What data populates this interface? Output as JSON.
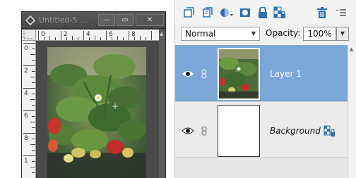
{
  "document_window": {
    "title": "Untitled-5 ...",
    "min_glyph": "—",
    "max_glyph": "▭",
    "close_glyph": "✕",
    "ruler_top_ticks": [
      "0",
      "2",
      "4",
      "6",
      "8"
    ],
    "ruler_left_ticks": [
      "0",
      "2",
      "4",
      "6",
      "8",
      "1"
    ]
  },
  "layers_panel": {
    "blend_mode": "Normal",
    "opacity_label": "Opacity:",
    "opacity_value": "100%",
    "layers": [
      {
        "name": "Layer 1",
        "selected": true
      },
      {
        "name": "Background",
        "selected": false
      }
    ]
  },
  "colors": {
    "selected_row": "#7aa7d8",
    "window_dark": "#4b4b4b",
    "panel_bg": "#f0f0f0",
    "icon_blue": "#2e6fae"
  },
  "icons": [
    "app-icon",
    "new-layer-icon",
    "new-group-icon",
    "adjustment-layer-icon",
    "layer-mask-icon",
    "lock-icon",
    "lock-transparent-icon",
    "trash-icon",
    "panel-menu-icon",
    "eye-icon",
    "link-icon"
  ]
}
